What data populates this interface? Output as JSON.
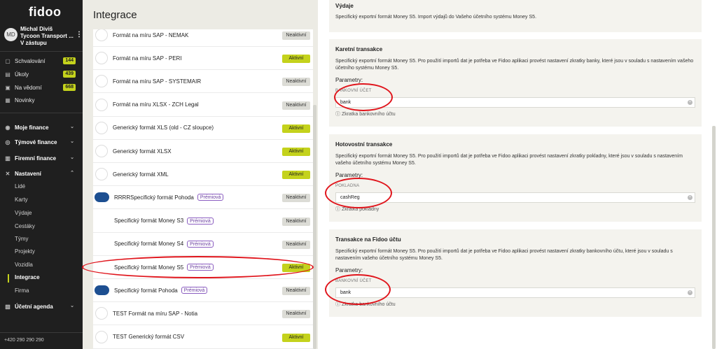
{
  "app": {
    "logo": "fidoo"
  },
  "user": {
    "initials": "MD",
    "name": "Michal Diviš",
    "company": "Tycoon Transport ...",
    "role": "V zástupu"
  },
  "nav": {
    "top": [
      {
        "label": "Schvalování",
        "badge": "144",
        "icon": "check-icon"
      },
      {
        "label": "Úkoly",
        "badge": "439",
        "icon": "task-icon"
      },
      {
        "label": "Na vědomí",
        "badge": "668",
        "icon": "info-icon"
      },
      {
        "label": "Novinky",
        "badge": "",
        "icon": "news-icon"
      }
    ],
    "sections": [
      {
        "label": "Moje finance"
      },
      {
        "label": "Týmové finance"
      },
      {
        "label": "Firemní finance"
      },
      {
        "label": "Nastavení"
      }
    ],
    "sub": [
      "Lidé",
      "Karty",
      "Výdaje",
      "Cestáky",
      "Týmy",
      "Projekty",
      "Vozidla",
      "Integrace",
      "Firma"
    ],
    "agenda": "Účetní agenda",
    "phone": "+420 290 290 290"
  },
  "middle": {
    "title": "Integrace",
    "premium_label": "Prémiová",
    "active_label": "Aktivní",
    "inactive_label": "Neaktivní",
    "rows": [
      {
        "name": "Formát na míru SAP - NEMAK",
        "status": "inactive",
        "logo": "fidoo",
        "premium": false
      },
      {
        "name": "Formát na míru SAP - PERI",
        "status": "active",
        "logo": "fidoo",
        "premium": false
      },
      {
        "name": "Formát na míru SAP - SYSTEMAIR",
        "status": "inactive",
        "logo": "fidoo",
        "premium": false
      },
      {
        "name": "Formát na míru XLSX - ZCH Legal",
        "status": "inactive",
        "logo": "fidoo",
        "premium": false
      },
      {
        "name": "Generický formát XLS (old - CZ sloupce)",
        "status": "active",
        "logo": "fidoo",
        "premium": false
      },
      {
        "name": "Generický formát XLSX",
        "status": "active",
        "logo": "fidoo",
        "premium": false
      },
      {
        "name": "Generický formát XML",
        "status": "active",
        "logo": "fidoo",
        "premium": false
      },
      {
        "name": "RRRRSpecifický formát Pohoda",
        "status": "inactive",
        "logo": "pohoda",
        "premium": true
      },
      {
        "name": "Specifický formát Money S3",
        "status": "inactive",
        "logo": "money",
        "premium": true
      },
      {
        "name": "Specifický formát Money S4",
        "status": "inactive",
        "logo": "money",
        "premium": true
      },
      {
        "name": "Specifický formát Money S5",
        "status": "active",
        "logo": "money",
        "premium": true
      },
      {
        "name": "Specifický formát Pohoda",
        "status": "inactive",
        "logo": "pohoda",
        "premium": true
      },
      {
        "name": "TEST Formát na míru SAP - Notia",
        "status": "inactive",
        "logo": "fidoo",
        "premium": false
      },
      {
        "name": "TEST Generický formát CSV",
        "status": "active",
        "logo": "fidoo",
        "premium": false
      }
    ]
  },
  "detail": {
    "params_label": "Parametry:",
    "cards": [
      {
        "title": "Výdaje",
        "desc": "Specifický exportní formát Money S5. Import výdajů do Vašeho účetního systému Money S5."
      },
      {
        "title": "Karetní transakce",
        "desc": "Specifický exportní formát Money S5. Pro použití importů dat je potřeba ve Fidoo aplikaci provést nastavení zkratky banky, které jsou v souladu s nastavením vašeho účetního systému Money S5.",
        "field_label": "BANKOVNÍ ÚČET",
        "field_value": "bank",
        "hint": "Zkratka bankovního účtu"
      },
      {
        "title": "Hotovostní transakce",
        "desc": "Specifický exportní formát Money S5. Pro použití importů dat je potřeba ve Fidoo aplikaci provést nastavení zkratky pokladny, které jsou v souladu s nastavením vašeho účetního systému Money S5.",
        "field_label": "POKLADNA",
        "field_value": "cashReg",
        "hint": "Zkratka pokladny"
      },
      {
        "title": "Transakce na Fidoo účtu",
        "desc": "Specifický exportní formát Money S5. Pro použití importů dat je potřeba ve Fidoo aplikaci provést nastavení zkratky bankovního účtu, které jsou v souladu s nastavením vašeho účetního systému Money S5.",
        "field_label": "BANKOVNÍ ÚČET",
        "field_value": "bank",
        "hint": "Zkratka bankovního účtu"
      }
    ]
  }
}
